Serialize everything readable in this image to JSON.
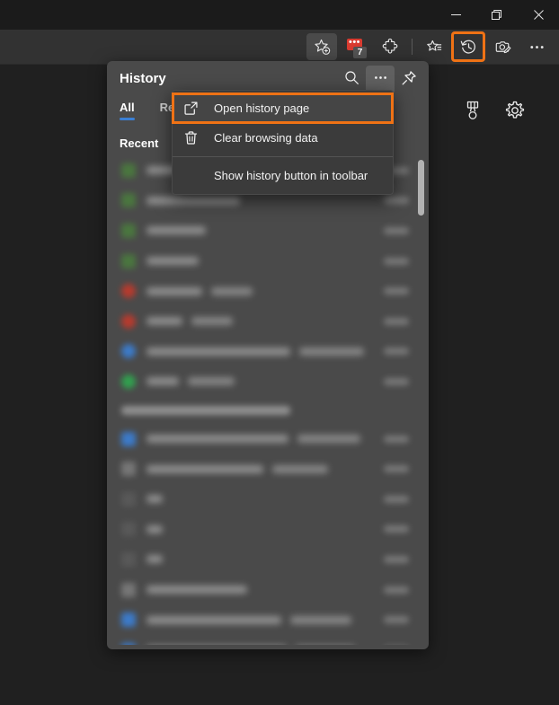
{
  "window": {
    "controls": [
      {
        "name": "minimize",
        "label": "Minimize"
      },
      {
        "name": "maximize",
        "label": "Restore"
      },
      {
        "name": "close",
        "label": "Close"
      }
    ]
  },
  "toolbar": {
    "add_favorite_label": "Add this page to favorites",
    "collections_badge_count": "7",
    "collections_label": "Collections",
    "extensions_label": "Extensions",
    "favorites_label": "Favorites",
    "history_label": "History",
    "split_screen_label": "Split screen",
    "settings_more_label": "Settings and more"
  },
  "page_icons": {
    "rewards_label": "Microsoft Rewards",
    "settings_label": "Settings"
  },
  "history_panel": {
    "title": "History",
    "search_label": "Search history",
    "more_options_label": "More options",
    "pin_label": "Pin history pane",
    "tabs": [
      {
        "label": "All",
        "selected": true
      },
      {
        "label": "Rec",
        "selected": false
      }
    ],
    "section_heading": "Recent"
  },
  "context_menu": {
    "items": [
      {
        "label": "Open history page",
        "icon": "open-external-icon",
        "focused": true,
        "separator_after": false
      },
      {
        "label": "Clear browsing data",
        "icon": "trash-icon",
        "focused": false,
        "separator_after": true
      },
      {
        "label": "Show history button in toolbar",
        "icon": "none",
        "focused": false,
        "separator_after": false
      }
    ]
  },
  "colors": {
    "highlight": "#ef7215",
    "accent": "#3b7fd4",
    "panel_bg": "#4a4a4a",
    "menu_bg": "#3b3b3b",
    "toolbar_bg": "#323232",
    "titlebar_bg": "#1b1b1b",
    "page_bg": "#202020"
  },
  "history_rows": [
    {
      "favicon": "#4a7a3e",
      "favicon_shape": "sq",
      "title_w": 88,
      "title2_w": 0,
      "group": false
    },
    {
      "favicon": "#4a7a3e",
      "favicon_shape": "sq",
      "title_w": 104,
      "title2_w": 0,
      "group": false
    },
    {
      "favicon": "#4a7a3e",
      "favicon_shape": "sq",
      "title_w": 66,
      "title2_w": 0,
      "group": false
    },
    {
      "favicon": "#4a7a3e",
      "favicon_shape": "sq",
      "title_w": 58,
      "title2_w": 0,
      "group": false
    },
    {
      "favicon": "#c0392b",
      "favicon_shape": "circle",
      "title_w": 62,
      "title2_w": 46,
      "group": false
    },
    {
      "favicon": "#c0392b",
      "favicon_shape": "circle",
      "title_w": 40,
      "title2_w": 46,
      "group": false
    },
    {
      "favicon": "#3b7fd4",
      "favicon_shape": "circle",
      "title_w": 160,
      "title2_w": 72,
      "group": false
    },
    {
      "favicon": "#2fa84f",
      "favicon_shape": "circle",
      "title_w": 36,
      "title2_w": 52,
      "group": false
    },
    {
      "favicon": "",
      "favicon_shape": "",
      "title_w": 0,
      "title2_w": 0,
      "group": true,
      "group_w": 188
    },
    {
      "favicon": "#3b7fd4",
      "favicon_shape": "sq",
      "title_w": 158,
      "title2_w": 70,
      "group": false
    },
    {
      "favicon": "#7a7a7a",
      "favicon_shape": "sq",
      "title_w": 130,
      "title2_w": 62,
      "group": false
    },
    {
      "favicon": "#5a5a5a",
      "favicon_shape": "sq",
      "title_w": 18,
      "title2_w": 0,
      "group": false
    },
    {
      "favicon": "#5a5a5a",
      "favicon_shape": "sq",
      "title_w": 18,
      "title2_w": 0,
      "group": false
    },
    {
      "favicon": "#5a5a5a",
      "favicon_shape": "sq",
      "title_w": 18,
      "title2_w": 0,
      "group": false
    },
    {
      "favicon": "#7a7a7a",
      "favicon_shape": "sq",
      "title_w": 112,
      "title2_w": 0,
      "group": false
    },
    {
      "favicon": "#3b7fd4",
      "favicon_shape": "sq",
      "title_w": 150,
      "title2_w": 68,
      "group": false
    },
    {
      "favicon": "#3b7fd4",
      "favicon_shape": "sq",
      "title_w": 156,
      "title2_w": 66,
      "group": false
    }
  ]
}
